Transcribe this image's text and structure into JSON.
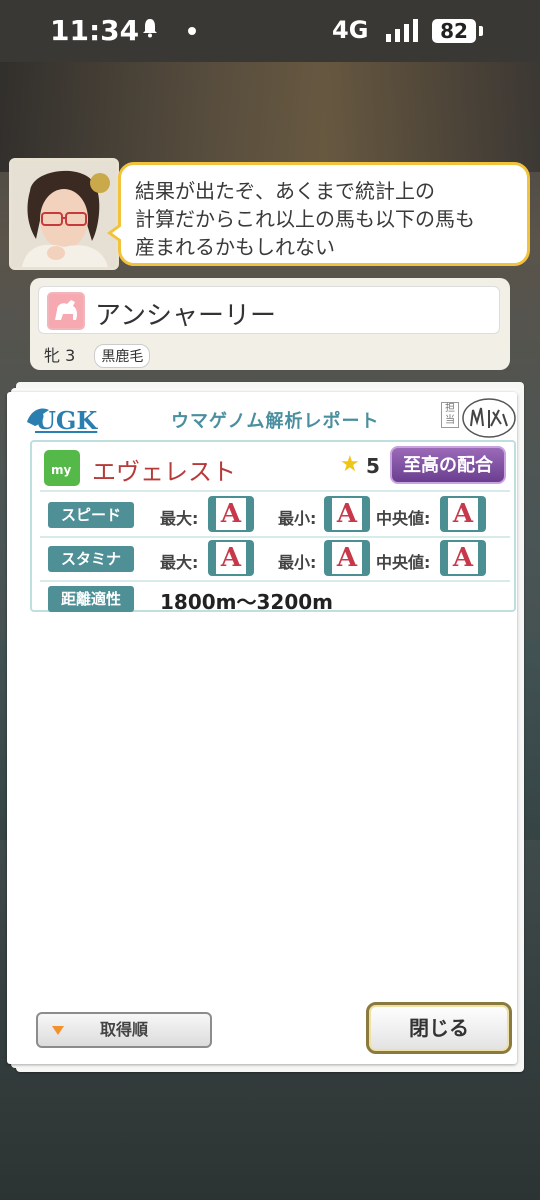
{
  "status_bar": {
    "time": "11:34",
    "network": "4G",
    "battery": "82"
  },
  "dialogue": {
    "speaker_portrait": "researcher-portrait",
    "text_line1": "結果が出たぞ、あくまで統計上の",
    "text_line2": "計算だからこれ以上の馬も以下の馬も",
    "text_line3": "産まれるかもしれない"
  },
  "horse": {
    "name": "アンシャーリー",
    "sex_age": "牝 3",
    "coat": "黒鹿毛"
  },
  "report": {
    "logo": "UGK",
    "title": "ウマゲノム解析レポート",
    "stamp_label": "担当",
    "stamp_signature": "山科",
    "factor": {
      "badge": "my",
      "name": "エヴェレスト",
      "stars": "5",
      "combo_label": "至高の配合"
    },
    "rows": [
      {
        "label": "スピード",
        "max_label": "最大:",
        "max": "A",
        "min_label": "最小:",
        "min": "A",
        "median_label": "中央値:",
        "median": "A"
      },
      {
        "label": "スタミナ",
        "max_label": "最大:",
        "max": "A",
        "min_label": "最小:",
        "min": "A",
        "median_label": "中央値:",
        "median": "A"
      }
    ],
    "distance_label": "距離適性",
    "distance_value": "1800m〜3200m"
  },
  "buttons": {
    "sort_label": "取得順",
    "close_label": "閉じる"
  },
  "colors": {
    "accent_teal": "#4f8f96",
    "grade_red": "#c7384a",
    "factor_red": "#b73a3a",
    "combo_purple": "#7a4a9e",
    "speech_border": "#f2c23c"
  }
}
